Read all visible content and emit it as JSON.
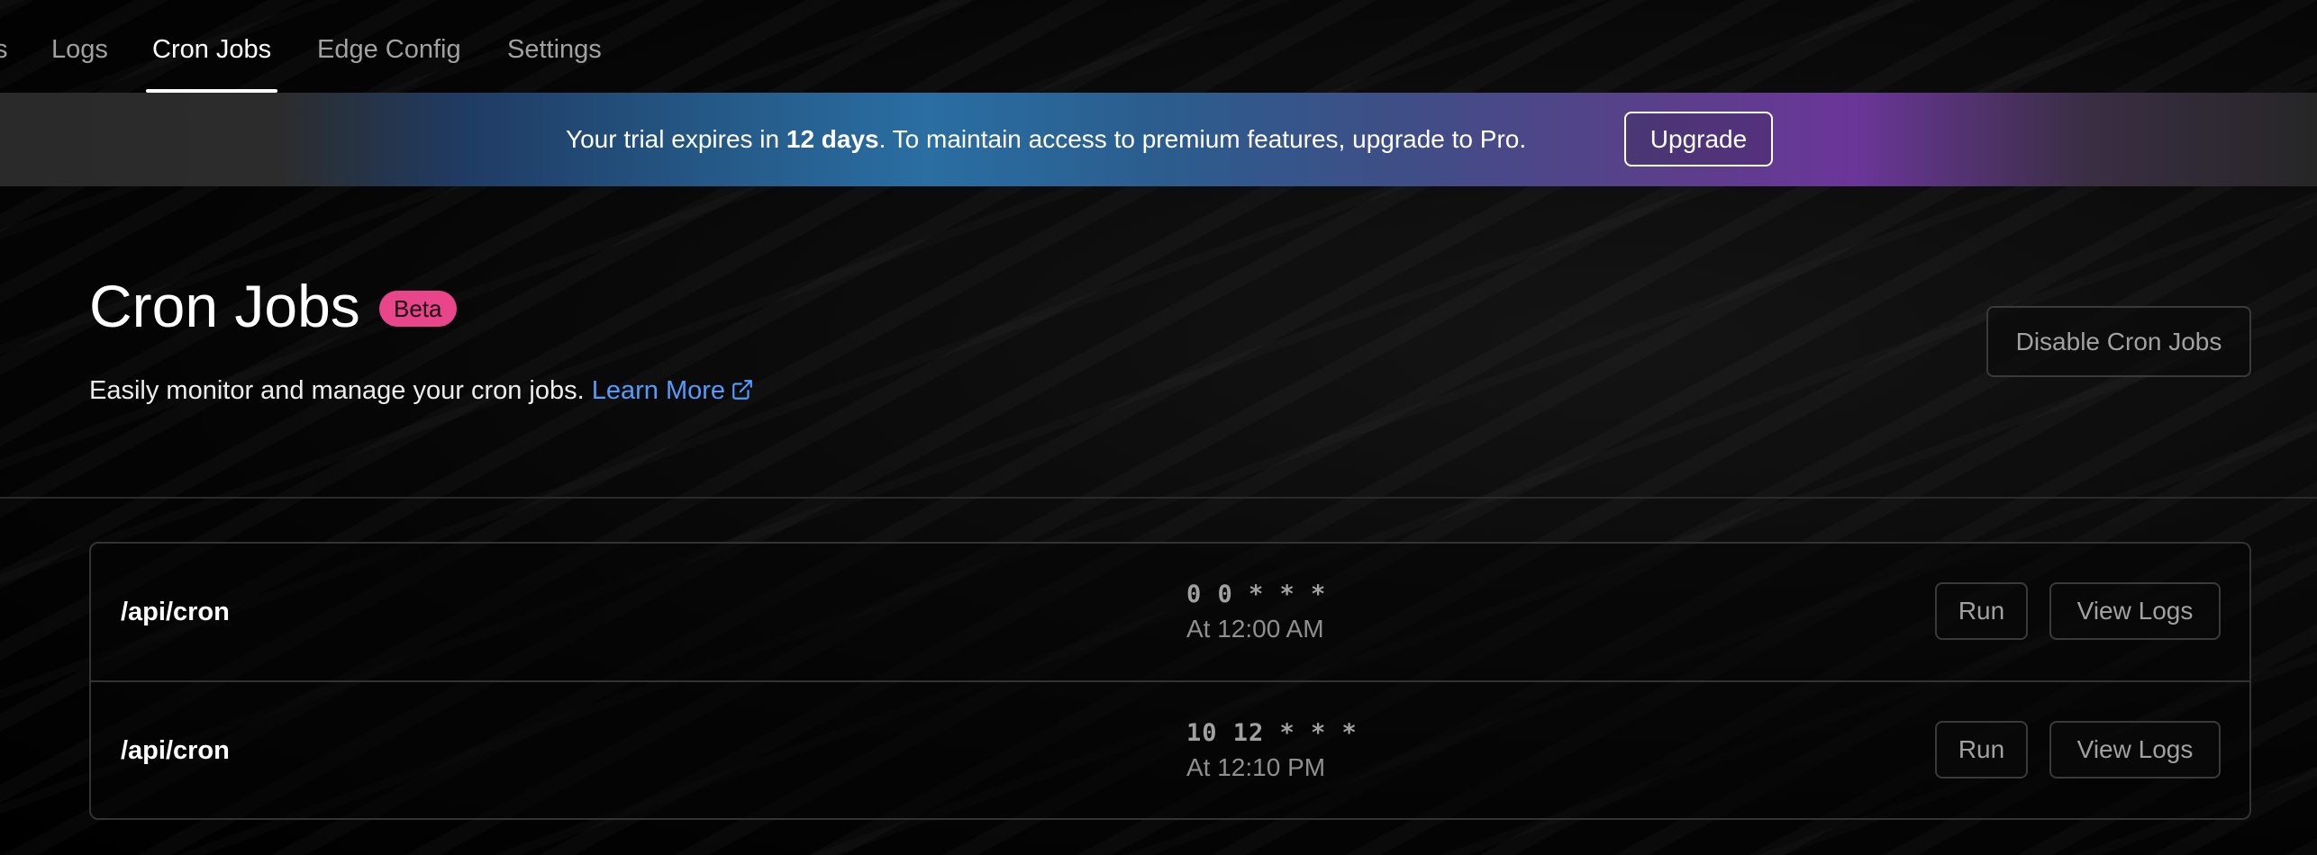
{
  "nav": {
    "tabs": [
      {
        "label": "s",
        "active": false
      },
      {
        "label": "Logs",
        "active": false
      },
      {
        "label": "Cron Jobs",
        "active": true
      },
      {
        "label": "Edge Config",
        "active": false
      },
      {
        "label": "Settings",
        "active": false
      }
    ]
  },
  "banner": {
    "text_before": "Your trial expires in ",
    "text_bold": "12 days",
    "text_after": ". To maintain access to premium features, upgrade to Pro.",
    "upgrade_label": "Upgrade"
  },
  "header": {
    "title": "Cron Jobs",
    "badge": "Beta",
    "subtitle": "Easily monitor and manage your cron jobs.",
    "learn_more": "Learn More",
    "learn_more_icon": "external-link-icon",
    "disable_label": "Disable Cron Jobs"
  },
  "jobs": [
    {
      "path": "/api/cron",
      "cron": "0 0 * * *",
      "description": "At 12:00 AM",
      "run_label": "Run",
      "logs_label": "View Logs"
    },
    {
      "path": "/api/cron",
      "cron": "10 12 * * *",
      "description": "At 12:10 PM",
      "run_label": "Run",
      "logs_label": "View Logs"
    }
  ],
  "colors": {
    "background": "#000000",
    "badge": "#e8458b",
    "link": "#529cff",
    "banner_blue": "#2a6ea2",
    "banner_purple": "#6a3699"
  }
}
